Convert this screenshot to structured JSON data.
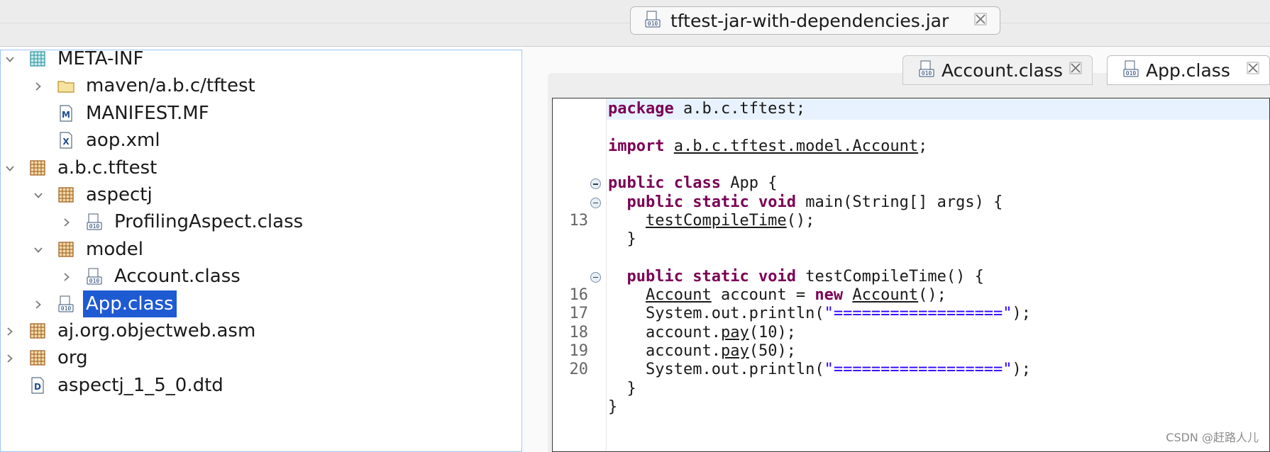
{
  "window": {
    "jar_tab_label": "tftest-jar-with-dependencies.jar"
  },
  "tree": {
    "items": [
      {
        "label": "META-INF",
        "icon": "package-folder-icon",
        "expanded": true,
        "depth": 0
      },
      {
        "label": "maven/a.b.c/tftest",
        "icon": "folder-icon",
        "expanded": false,
        "depth": 1
      },
      {
        "label": "MANIFEST.MF",
        "icon": "manifest-file-icon",
        "depth": 1
      },
      {
        "label": "aop.xml",
        "icon": "xml-file-icon",
        "depth": 1
      },
      {
        "label": "a.b.c.tftest",
        "icon": "package-icon",
        "expanded": true,
        "depth": 0
      },
      {
        "label": "aspectj",
        "icon": "package-icon",
        "expanded": true,
        "depth": 1
      },
      {
        "label": "ProfilingAspect.class",
        "icon": "class-file-icon",
        "expanded": false,
        "depth": 2
      },
      {
        "label": "model",
        "icon": "package-icon",
        "expanded": true,
        "depth": 1
      },
      {
        "label": "Account.class",
        "icon": "class-file-icon",
        "expanded": false,
        "depth": 2
      },
      {
        "label": "App.class",
        "icon": "class-file-icon",
        "expanded": false,
        "depth": 1,
        "selected": true
      },
      {
        "label": "aj.org.objectweb.asm",
        "icon": "package-icon",
        "expanded": false,
        "depth": 0
      },
      {
        "label": "org",
        "icon": "package-icon",
        "expanded": false,
        "depth": 0
      },
      {
        "label": "aspectj_1_5_0.dtd",
        "icon": "dtd-file-icon",
        "depth": 0
      }
    ]
  },
  "editor_tabs": [
    {
      "label": "Account.class",
      "active": false
    },
    {
      "label": "App.class",
      "active": true
    }
  ],
  "code": {
    "lines": [
      {
        "num": "",
        "fold": false,
        "text": "package a.b.c.tftest;"
      },
      {
        "num": "",
        "fold": false,
        "text": ""
      },
      {
        "num": "",
        "fold": false,
        "text": "import a.b.c.tftest.model.Account;"
      },
      {
        "num": "",
        "fold": false,
        "text": ""
      },
      {
        "num": "",
        "fold": true,
        "text": "public class App {"
      },
      {
        "num": "",
        "fold": true,
        "text": "  public static void main(String[] args) {"
      },
      {
        "num": "13",
        "fold": false,
        "text": "    testCompileTime();"
      },
      {
        "num": "",
        "fold": false,
        "text": "  }"
      },
      {
        "num": "",
        "fold": false,
        "text": ""
      },
      {
        "num": "",
        "fold": true,
        "text": "  public static void testCompileTime() {"
      },
      {
        "num": "16",
        "fold": false,
        "text": "    Account account = new Account();"
      },
      {
        "num": "17",
        "fold": false,
        "text": "    System.out.println(\"==================\");"
      },
      {
        "num": "18",
        "fold": false,
        "text": "    account.pay(10);"
      },
      {
        "num": "19",
        "fold": false,
        "text": "    account.pay(50);"
      },
      {
        "num": "20",
        "fold": false,
        "text": "    System.out.println(\"==================\");"
      },
      {
        "num": "",
        "fold": false,
        "text": "  }"
      },
      {
        "num": "",
        "fold": false,
        "text": "}"
      }
    ]
  },
  "watermark": "CSDN @赶路人儿"
}
